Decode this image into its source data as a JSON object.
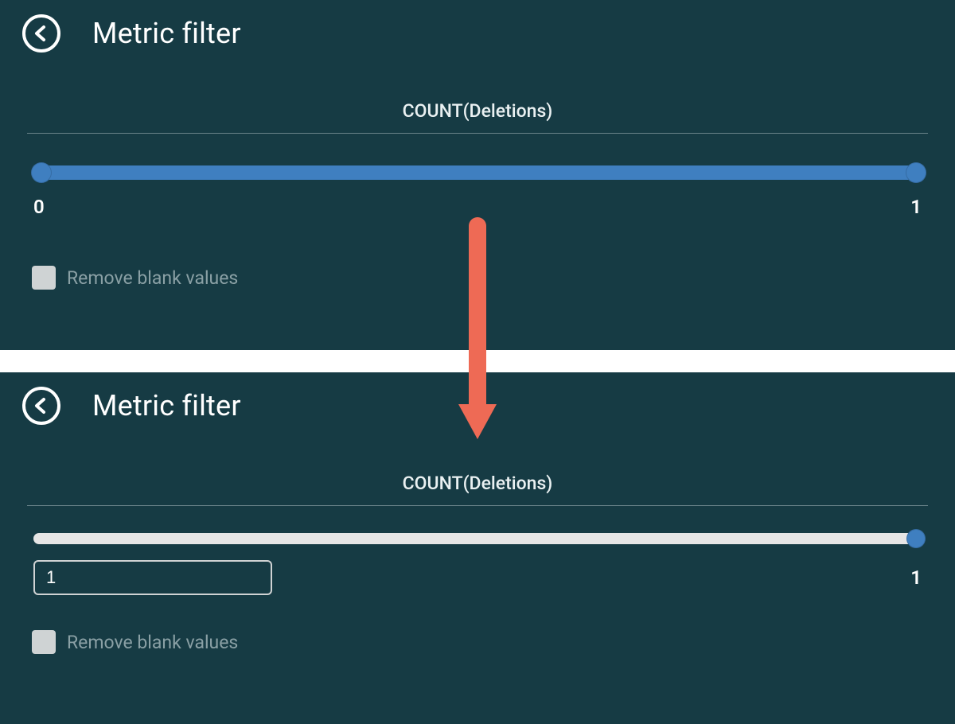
{
  "top": {
    "title": "Metric filter",
    "metric": "COUNT(Deletions)",
    "slider": {
      "min": "0",
      "max": "1",
      "fill_pct": 100,
      "handle_left_pct": 0.9,
      "handle_right_pct": 99.4
    },
    "checkbox": {
      "label": "Remove blank values",
      "checked": false
    }
  },
  "bottom": {
    "title": "Metric filter",
    "metric": "COUNT(Deletions)",
    "slider": {
      "max": "1",
      "fill_pct": 0,
      "handle_right_pct": 99.4
    },
    "input": {
      "value": "1"
    },
    "checkbox": {
      "label": "Remove blank values",
      "checked": false
    }
  },
  "colors": {
    "bg": "#163b44",
    "slider_active": "#3f7fc0",
    "slider_inactive": "#e6e6e6",
    "arrow": "#ee6a55"
  }
}
